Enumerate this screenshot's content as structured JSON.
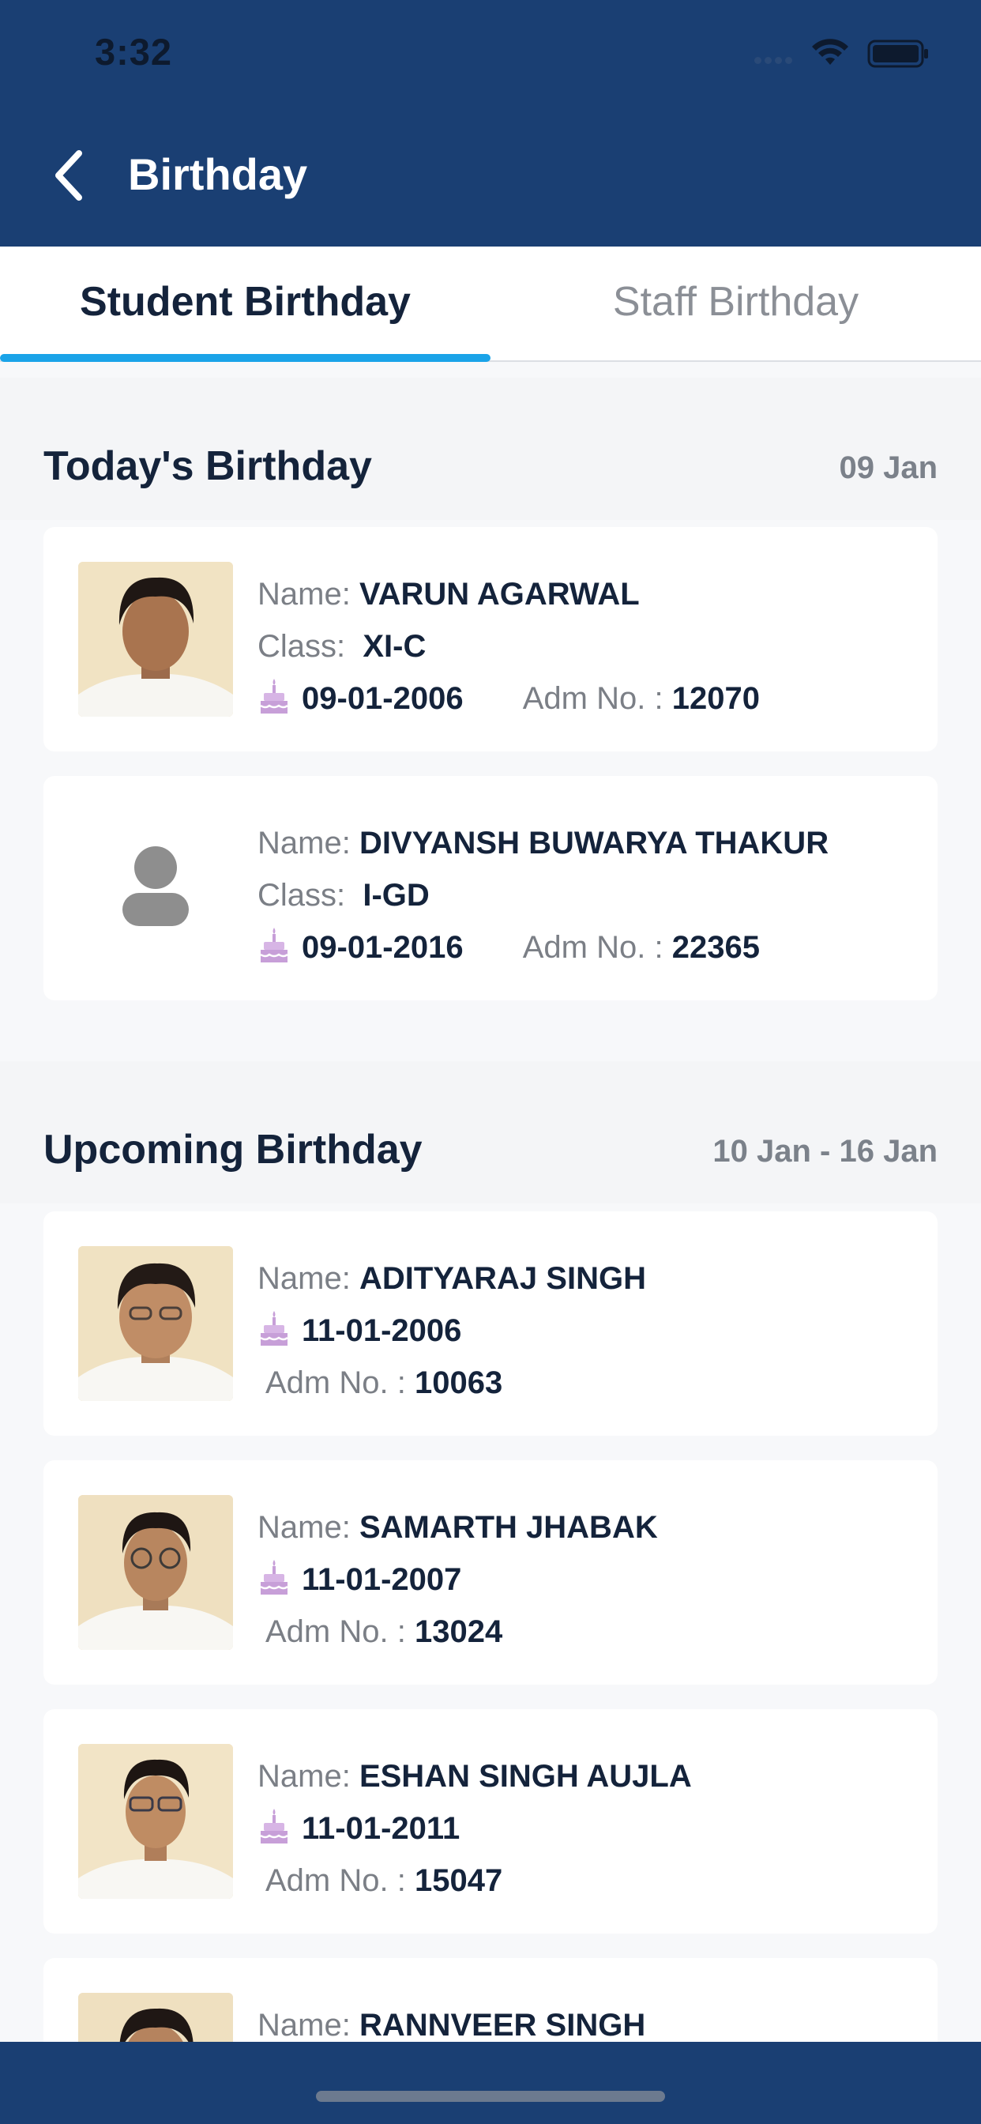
{
  "status_bar": {
    "time": "3:32"
  },
  "nav": {
    "title": "Birthday"
  },
  "tabs": [
    {
      "label": "Student Birthday",
      "active": true
    },
    {
      "label": "Staff Birthday",
      "active": false
    }
  ],
  "labels": {
    "name": "Name:",
    "class": "Class:",
    "adm": "Adm No. :"
  },
  "today": {
    "title": "Today's Birthday",
    "date": "09 Jan",
    "students": [
      {
        "name": "VARUN AGARWAL",
        "class": "XI-C",
        "dob": "09-01-2006",
        "adm": "12070",
        "photo": true
      },
      {
        "name": "DIVYANSH BUWARYA THAKUR",
        "class": "I-GD",
        "dob": "09-01-2016",
        "adm": "22365",
        "photo": false
      }
    ]
  },
  "upcoming": {
    "title": "Upcoming Birthday",
    "date": "10 Jan - 16 Jan",
    "students": [
      {
        "name": "ADITYARAJ SINGH",
        "dob": "11-01-2006",
        "adm": "10063",
        "photo": true
      },
      {
        "name": "SAMARTH JHABAK",
        "dob": "11-01-2007",
        "adm": "13024",
        "photo": true
      },
      {
        "name": "ESHAN SINGH AUJLA",
        "dob": "11-01-2011",
        "adm": "15047",
        "photo": true
      },
      {
        "name": "RANNVEER SINGH",
        "photo": true
      }
    ]
  },
  "colors": {
    "header": "#1a3f73",
    "tab_indicator": "#1aa3e8",
    "cake_icon": "#c79fd8"
  }
}
